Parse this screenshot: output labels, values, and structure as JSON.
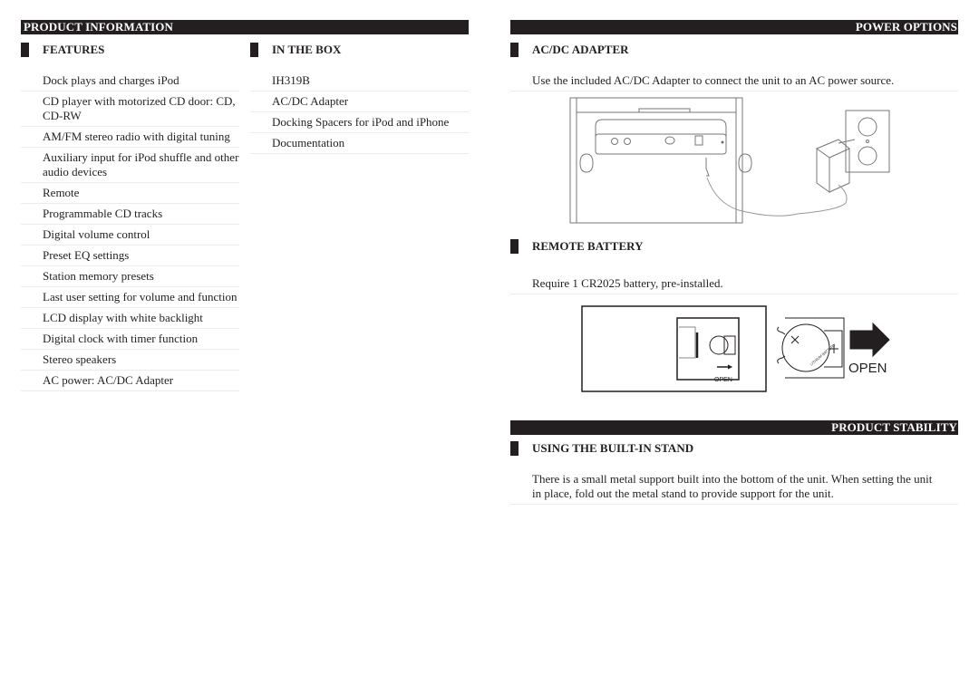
{
  "product_information": {
    "title": "PRODUCT INFORMATION",
    "features": {
      "heading": "FEATURES",
      "items": [
        "Dock plays and charges iPod",
        "CD player with motorized CD door: CD, CD-RW",
        "AM/FM stereo radio with digital tuning",
        "Auxiliary input for iPod shuffle and other audio devices",
        "Remote",
        "Programmable CD tracks",
        "Digital volume control",
        "Preset EQ settings",
        "Station memory presets",
        "Last user setting for volume and function",
        "LCD display with white backlight",
        "Digital clock with timer function",
        "Stereo speakers",
        "AC power: AC/DC Adapter"
      ]
    },
    "in_the_box": {
      "heading": "IN THE BOX",
      "items": [
        "IH319B",
        "AC/DC Adapter",
        "Docking Spacers for iPod and iPhone",
        "Documentation"
      ]
    }
  },
  "power_options": {
    "title": "POWER OPTIONS",
    "ac_dc_adapter": {
      "heading": "AC/DC ADAPTER",
      "text": "Use the included AC/DC Adapter to connect the unit to an AC power source."
    },
    "remote_battery": {
      "heading": "REMOTE BATTERY",
      "text": "Require 1 CR2025 battery, pre-installed.",
      "figure_labels": {
        "small_open": "OPEN",
        "large_open": "OPEN",
        "battery_text_1": "LITHIUM BATTERY",
        "battery_text_2": "CR 2025",
        "battery_text_3": "3V"
      }
    }
  },
  "product_stability": {
    "title": "PRODUCT STABILITY",
    "built_in_stand": {
      "heading": "USING THE BUILT-IN STAND",
      "text": "There is a small metal support built into the bottom of the unit. When setting the unit in place, fold out the metal stand to provide support for the unit."
    }
  },
  "colors": {
    "bar": "#231f20",
    "text": "#231f20",
    "divider": "#ececec"
  }
}
